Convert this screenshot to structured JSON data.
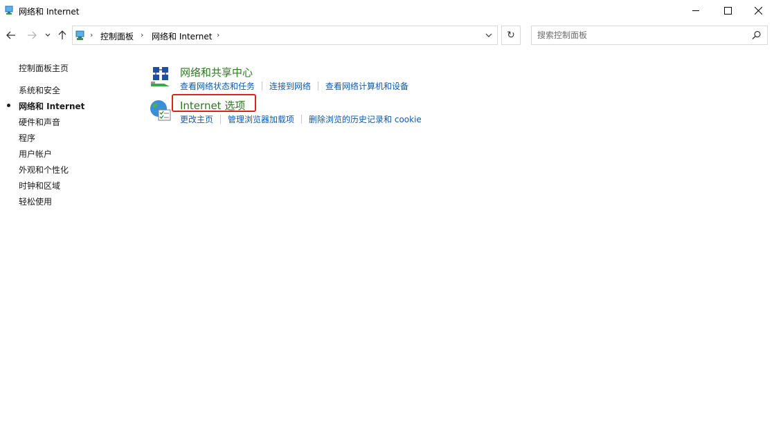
{
  "window": {
    "title": "网络和 Internet"
  },
  "navigation": {
    "breadcrumb": [
      "控制面板",
      "网络和 Internet"
    ],
    "search_placeholder": "搜索控制面板"
  },
  "sidebar": {
    "home": "控制面板主页",
    "items": [
      {
        "label": "系统和安全",
        "active": false
      },
      {
        "label": "网络和 Internet",
        "active": true
      },
      {
        "label": "硬件和声音",
        "active": false
      },
      {
        "label": "程序",
        "active": false
      },
      {
        "label": "用户帐户",
        "active": false
      },
      {
        "label": "外观和个性化",
        "active": false
      },
      {
        "label": "时钟和区域",
        "active": false
      },
      {
        "label": "轻松使用",
        "active": false
      }
    ]
  },
  "main": {
    "categories": [
      {
        "title": "网络和共享中心",
        "links": [
          "查看网络状态和任务",
          "连接到网络",
          "查看网络计算机和设备"
        ]
      },
      {
        "title": "Internet 选项",
        "links": [
          "更改主页",
          "管理浏览器加载项",
          "删除浏览的历史记录和 cookie"
        ]
      }
    ]
  },
  "colors": {
    "category_title": "#2a7a1e",
    "link": "#0b5bb5",
    "highlight": "#e02020"
  }
}
